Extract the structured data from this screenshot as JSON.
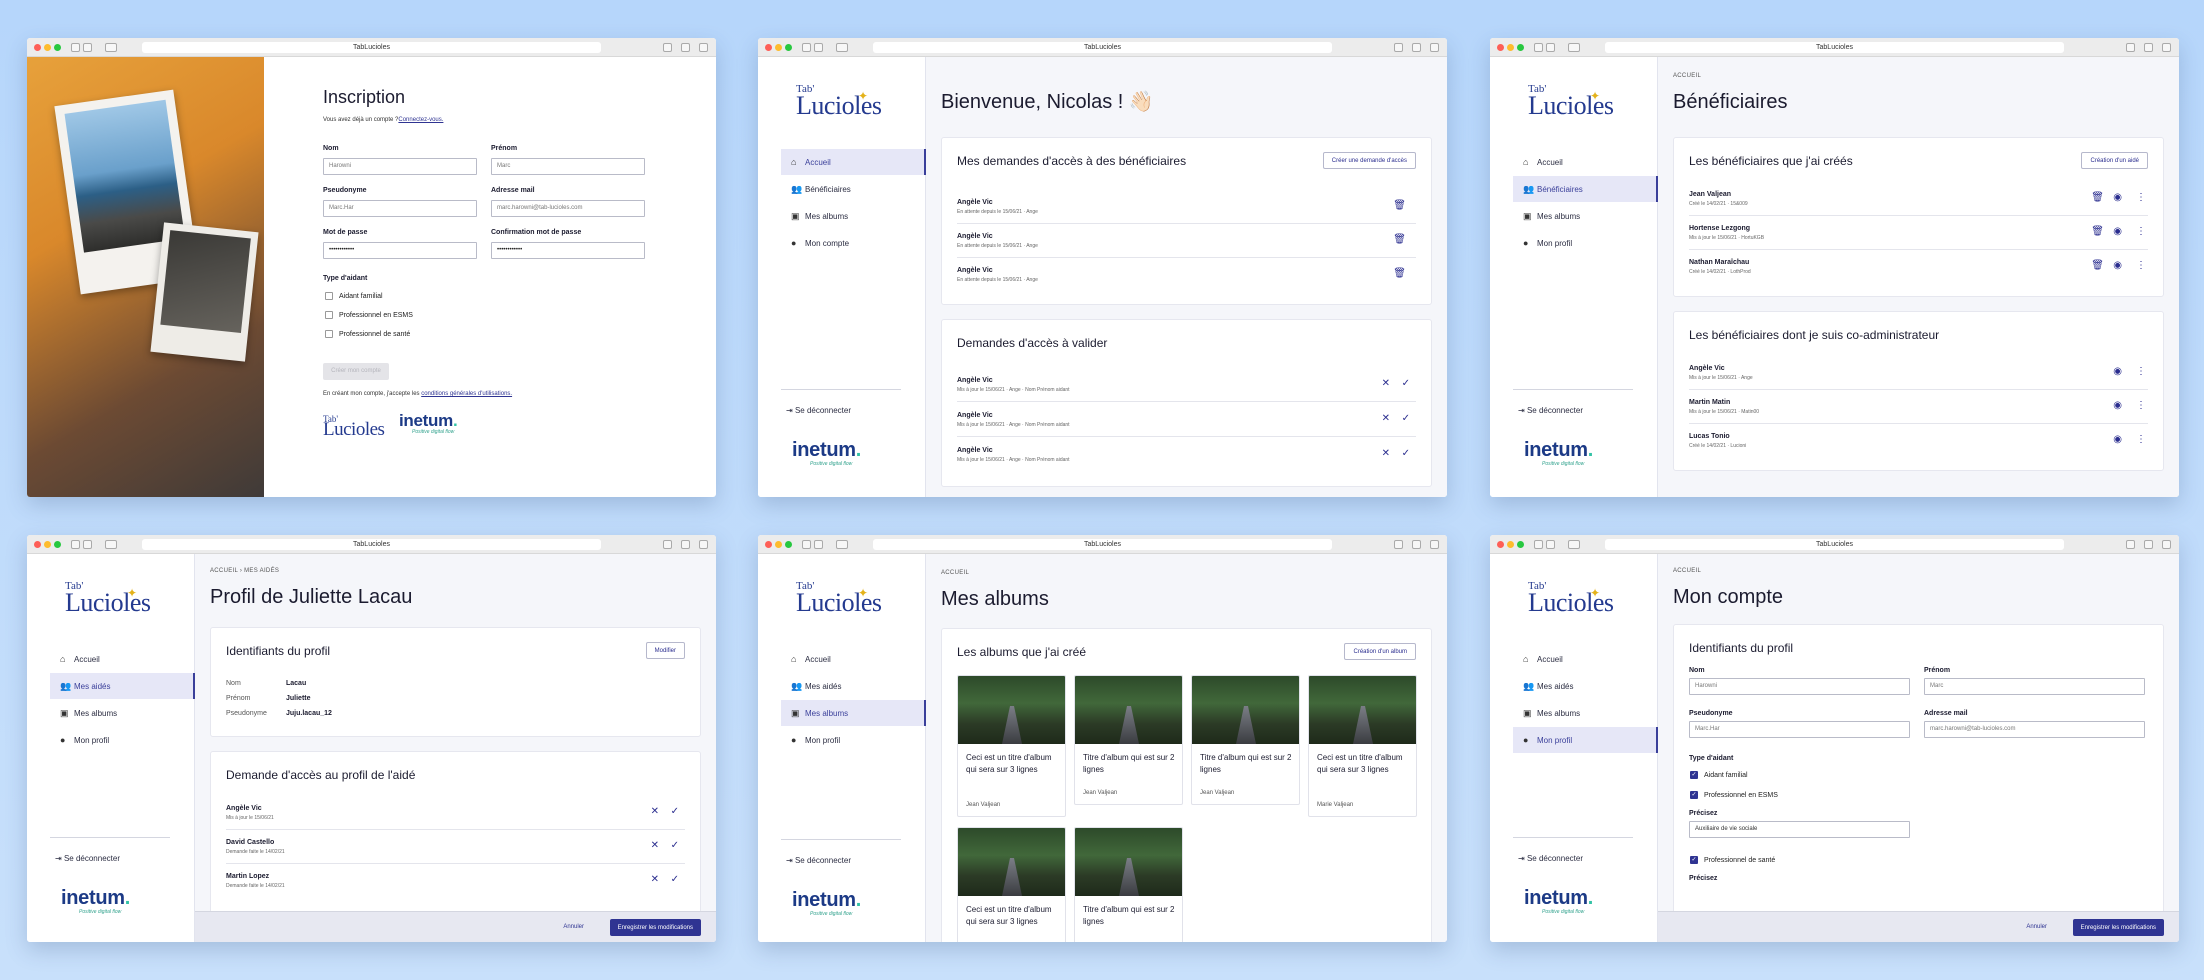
{
  "url": "TabLucioles",
  "logo": {
    "top": "Tab'",
    "main": "Lucioles"
  },
  "inetum": {
    "name": "inetum",
    "tagline": "Positive digital flow"
  },
  "nav": {
    "home": "Accueil",
    "benef": "Bénéficiaires",
    "aides": "Mes aidés",
    "albums": "Mes albums",
    "account": "Mon compte",
    "profile": "Mon profil",
    "logout": "Se déconnecter"
  },
  "w1": {
    "title": "Inscription",
    "already": "Vous avez déjà un compte ?",
    "connect": "Connectez-vous.",
    "nom_l": "Nom",
    "nom_v": "Harowni",
    "prenom_l": "Prénom",
    "prenom_v": "Marc",
    "pseudo_l": "Pseudonyme",
    "pseudo_v": "Marc.Har",
    "email_l": "Adresse mail",
    "email_v": "marc.harowni@tab-lucioles.com",
    "mdp_l": "Mot de passe",
    "mdp_v": "••••••••••••",
    "conf_l": "Confirmation mot de passe",
    "conf_v": "••••••••••••",
    "type_l": "Type d'aidant",
    "opt1": "Aidant familial",
    "opt2": "Professionnel en ESMS",
    "opt3": "Professionnel de santé",
    "create": "Créer mon compte",
    "terms": "En créant mon compte, j'accepte les ",
    "terms_link": "conditions générales d'utilisations."
  },
  "w2": {
    "title": "Bienvenue, Nicolas ! 👋🏻",
    "card1": "Mes demandes d'accès à des bénéficiaires",
    "card1_btn": "Créer une demande d'accès",
    "rows1": [
      {
        "name": "Angèle Vic",
        "sub": "En attente depuis le 15/06/21  ·  Ange"
      },
      {
        "name": "Angèle Vic",
        "sub": "En attente depuis le 15/06/21  ·  Ange"
      },
      {
        "name": "Angèle Vic",
        "sub": "En attente depuis le 15/06/21  ·  Ange"
      }
    ],
    "card2": "Demandes d'accès à valider",
    "rows2": [
      {
        "name": "Angèle Vic",
        "sub": "Mis à jour le 15/06/21  ·  Ange  ·  Nom Prénom aidant"
      },
      {
        "name": "Angèle Vic",
        "sub": "Mis à jour le 15/06/21  ·  Ange  ·  Nom Prénom aidant"
      },
      {
        "name": "Angèle Vic",
        "sub": "Mis à jour le 15/06/21  ·  Ange  ·  Nom Prénom aidant"
      }
    ]
  },
  "w3": {
    "crumb": "ACCUEIL",
    "title": "Bénéficiaires",
    "card1": "Les bénéficiaires que j'ai créés",
    "card1_btn": "Création d'un aidé",
    "rows1": [
      {
        "name": "Jean Valjean",
        "sub": "Créé le 14/02/21  ·  15&009"
      },
      {
        "name": "Hortense Lezgong",
        "sub": "Mis à jour le 15/06/21  ·  HortuKGB"
      },
      {
        "name": "Nathan Maraîchau",
        "sub": "Créé le 14/02/21  ·  LothProd"
      }
    ],
    "card2": "Les bénéficiaires dont je suis co-administrateur",
    "rows2": [
      {
        "name": "Angèle Vic",
        "sub": "Mis à jour le 15/06/21  ·  Ange"
      },
      {
        "name": "Martin Matin",
        "sub": "Mis à jour le 15/06/21  ·  Matin00"
      },
      {
        "name": "Lucas Tonio",
        "sub": "Créé le 14/02/21  ·  Lucioni"
      }
    ]
  },
  "w4": {
    "crumb1": "ACCUEIL",
    "crumb2": "MES AIDÉS",
    "title": "Profil de Juliette Lacau",
    "card1": "Identifiants du profil",
    "card1_btn": "Modifier",
    "f1l": "Nom",
    "f1v": "Lacau",
    "f2l": "Prénom",
    "f2v": "Juliette",
    "f3l": "Pseudonyme",
    "f3v": "Juju.lacau_12",
    "card2": "Demande d'accès au profil de l'aidé",
    "rows": [
      {
        "name": "Angèle Vic",
        "sub": "Mis à jour le 15/06/21"
      },
      {
        "name": "David Castello",
        "sub": "Demande faite le 14/02/21"
      },
      {
        "name": "Martin Lopez",
        "sub": "Demande faite le 14/02/21"
      }
    ],
    "cancel": "Annuler",
    "save": "Enregistrer les modifications"
  },
  "w5": {
    "crumb": "ACCUEIL",
    "title": "Mes albums",
    "card": "Les albums que j'ai créé",
    "card_btn": "Création d'un album",
    "albums": [
      {
        "t": "Ceci est un titre d'album qui sera sur 3 lignes",
        "a": "Jean Valjean"
      },
      {
        "t": "Titre d'album qui est sur 2 lignes",
        "a": "Jean Valjean"
      },
      {
        "t": "Titre d'album qui est sur 2 lignes",
        "a": "Jean Valjean"
      },
      {
        "t": "Ceci est un titre d'album qui sera sur 3 lignes",
        "a": "Marie Valjean"
      },
      {
        "t": "Ceci est un titre d'album qui sera sur 3 lignes",
        "a": ""
      },
      {
        "t": "Titre d'album qui est sur 2 lignes",
        "a": ""
      }
    ]
  },
  "w6": {
    "crumb": "ACCUEIL",
    "title": "Mon compte",
    "card": "Identifiants du profil",
    "nom_l": "Nom",
    "nom_v": "Harowni",
    "prenom_l": "Prénom",
    "prenom_v": "Marc",
    "pseudo_l": "Pseudonyme",
    "pseudo_v": "Marc.Har",
    "email_l": "Adresse mail",
    "email_v": "marc.harowni@tab-lucioles.com",
    "type_l": "Type d'aidant",
    "opt1": "Aidant familial",
    "opt2": "Professionnel en ESMS",
    "precisez": "Précisez",
    "precisez_v": "Auxiliaire de vie sociale",
    "opt3": "Professionnel de santé",
    "precisez2": "Précisez",
    "cancel": "Annuler",
    "save": "Enregistrer les modifications"
  }
}
